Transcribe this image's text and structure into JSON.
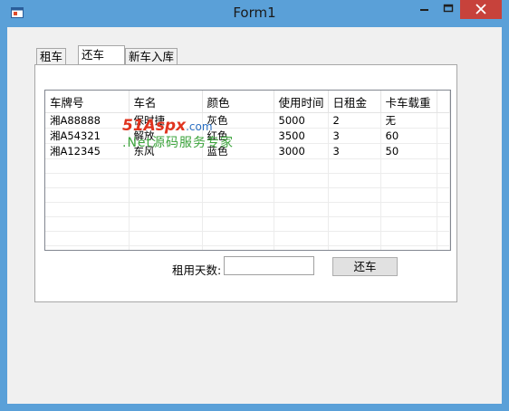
{
  "window": {
    "title": "Form1"
  },
  "tabs": [
    {
      "label": "租车",
      "active": false
    },
    {
      "label": "还车",
      "active": true
    },
    {
      "label": "新车入库",
      "active": false
    }
  ],
  "grid": {
    "columns": [
      "车牌号",
      "车名",
      "颜色",
      "使用时间",
      "日租金",
      "卡车载重"
    ],
    "rows": [
      [
        "湘A88888",
        "保时捷",
        "灰色",
        "5000",
        "2",
        "无"
      ],
      [
        "湘A54321",
        "解放",
        "红色",
        "3500",
        "3",
        "60"
      ],
      [
        "湘A12345",
        "东风",
        "蓝色",
        "3000",
        "3",
        "50"
      ]
    ]
  },
  "form": {
    "days_label": "租用天数:",
    "days_value": "",
    "return_button": "还车"
  },
  "watermark": {
    "brand": "51Aspx",
    "domain": ".com",
    "tagline": ".Net源码服务专家"
  },
  "colors": {
    "title_bar": "#5aa0d8",
    "close_button": "#c7423b",
    "client_bg": "#f0f0f0"
  }
}
